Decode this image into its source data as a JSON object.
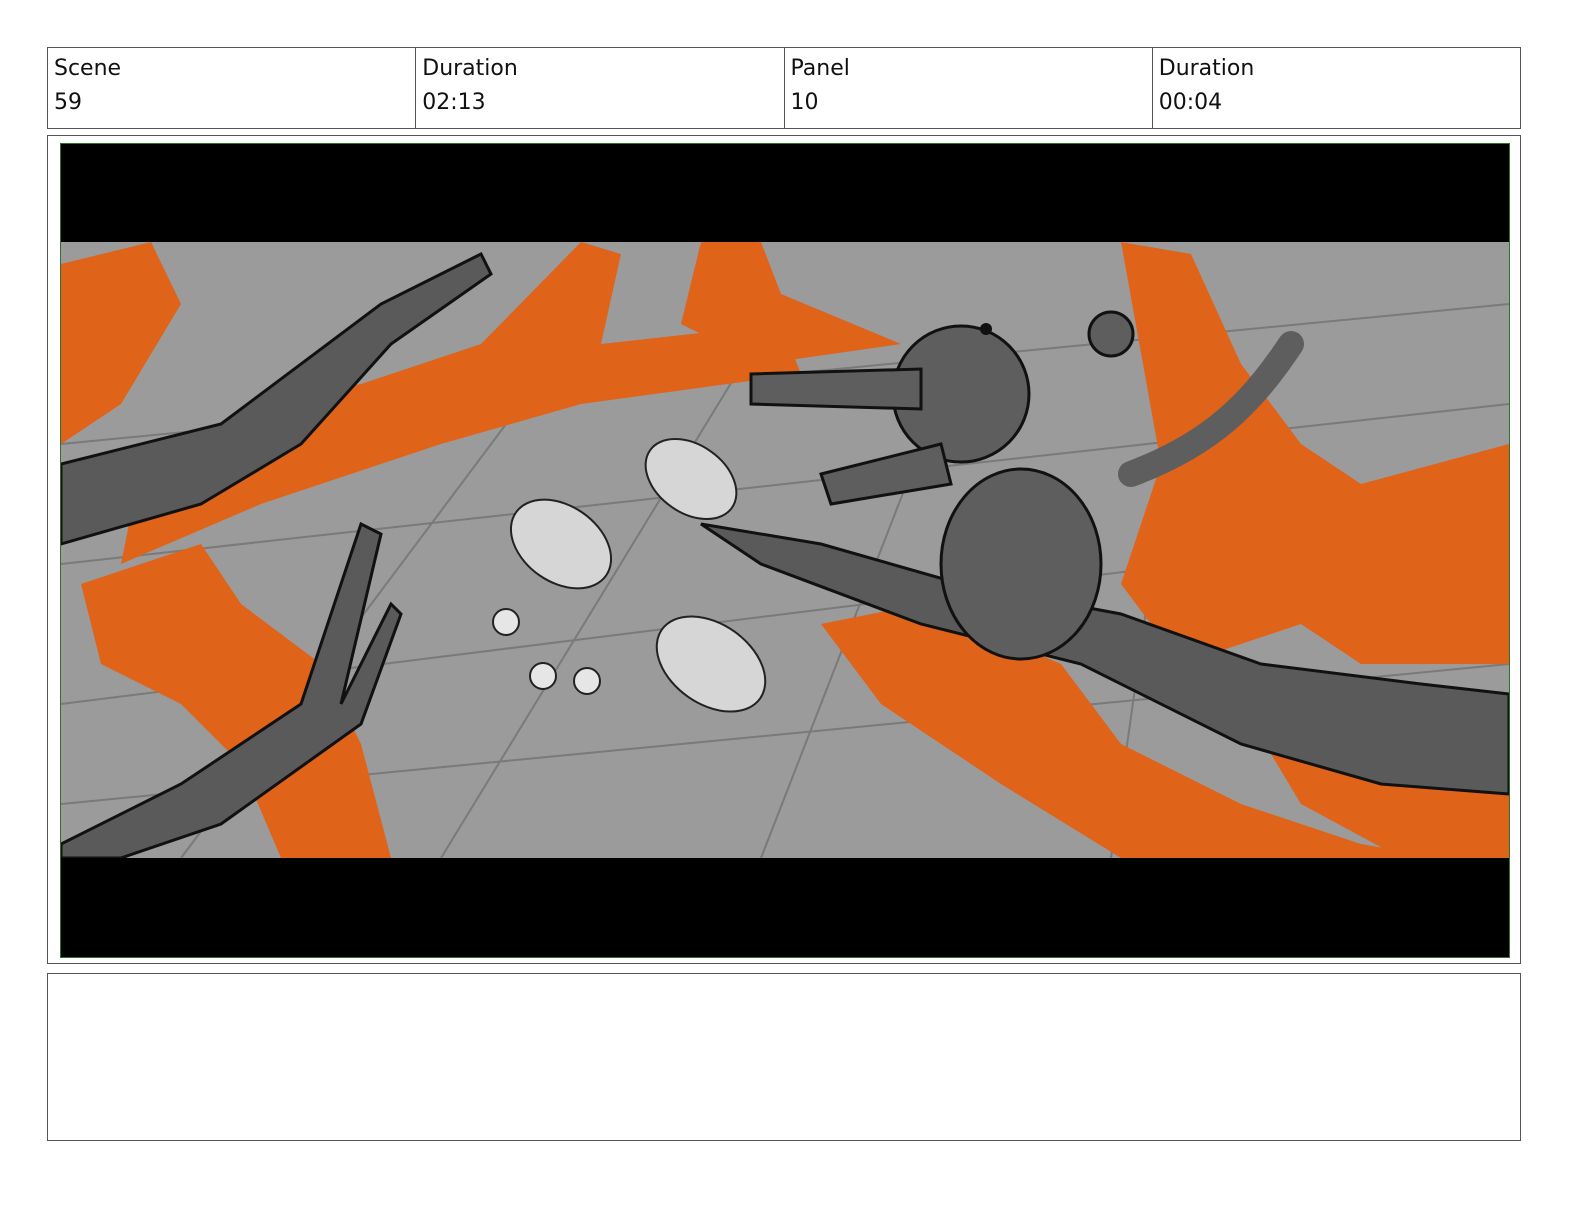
{
  "header": {
    "scene_label": "Scene",
    "scene_value": "59",
    "scene_duration_label": "Duration",
    "scene_duration_value": "02:13",
    "panel_label": "Panel",
    "panel_value": "10",
    "panel_duration_label": "Duration",
    "panel_duration_value": "00:04"
  },
  "artwork": {
    "subject": "storyboard-sketch",
    "colors": {
      "fire": "#e0631a",
      "ground": "#9a9a9a",
      "letterbox": "#000000",
      "frame": "#2f6f2f"
    }
  },
  "notes": {
    "text": ""
  }
}
